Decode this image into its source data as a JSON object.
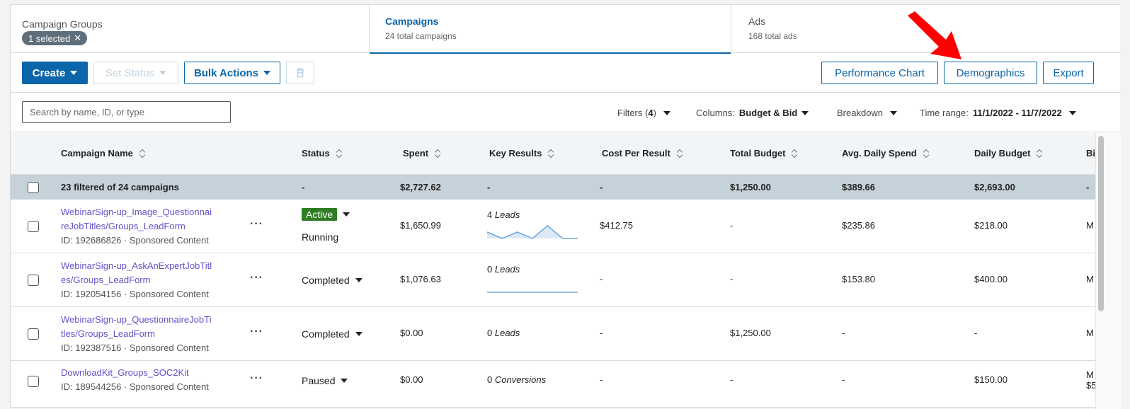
{
  "tabs": {
    "groups": {
      "title": "Campaign Groups",
      "chip": "1 selected"
    },
    "campaigns": {
      "title": "Campaigns",
      "sub": "24 total campaigns"
    },
    "ads": {
      "title": "Ads",
      "sub": "168 total ads"
    }
  },
  "toolbar": {
    "create": "Create",
    "set_status": "Set Status",
    "bulk_actions": "Bulk Actions",
    "performance_chart": "Performance Chart",
    "demographics": "Demographics",
    "export": "Export"
  },
  "filters": {
    "search_placeholder": "Search by name, ID, or type",
    "filters_label": "Filters (",
    "filters_count": "4",
    "filters_close": ")",
    "columns_label": "Columns:",
    "columns_value": "Budget & Bid",
    "breakdown": "Breakdown",
    "time_label": "Time range:",
    "time_value": "11/1/2022 - 11/7/2022"
  },
  "columns": [
    "Campaign Name",
    "Status",
    "Spent",
    "Key Results",
    "Cost Per Result",
    "Total Budget",
    "Avg. Daily Spend",
    "Daily Budget",
    "Bi"
  ],
  "summary": {
    "label": "23 filtered of 24 campaigns",
    "status": "-",
    "spent": "$2,727.62",
    "key_results": "-",
    "cost_per_result": "-",
    "total_budget": "$1,250.00",
    "avg_daily_spend": "$389.66",
    "daily_budget": "$2,693.00",
    "bid": "-"
  },
  "rows": [
    {
      "name_line1": "WebinarSign-up_Image_Questionnai",
      "name_line2": "reJobTitles/Groups_LeadForm",
      "meta": "ID: 192686826 · Sponsored Content",
      "status_badge": "Active",
      "status_sub": "Running",
      "spent": "$1,650.99",
      "kr_count": "4",
      "kr_unit": "Leads",
      "sparkline": [
        1,
        0,
        1,
        0,
        2,
        0,
        0
      ],
      "cost_per_result": "$412.75",
      "total_budget": "-",
      "avg_daily_spend": "$235.86",
      "daily_budget": "$218.00",
      "bid": "M"
    },
    {
      "name_line1": "WebinarSign-up_AskAnExpertJobTitl",
      "name_line2": "es/Groups_LeadForm",
      "meta": "ID: 192054156 · Sponsored Content",
      "status": "Completed",
      "spent": "$1,076.63",
      "kr_count": "0",
      "kr_unit": "Leads",
      "sparkline": [
        0,
        0,
        0,
        0,
        0,
        0,
        0
      ],
      "cost_per_result": "-",
      "total_budget": "-",
      "avg_daily_spend": "$153.80",
      "daily_budget": "$400.00",
      "bid": "M"
    },
    {
      "name_line1": "WebinarSign-up_QuestionnaireJobTi",
      "name_line2": "tles/Groups_LeadForm",
      "meta": "ID: 192387516 · Sponsored Content",
      "status": "Completed",
      "spent": "$0.00",
      "kr_count": "0",
      "kr_unit": "Leads",
      "cost_per_result": "-",
      "total_budget": "$1,250.00",
      "avg_daily_spend": "-",
      "daily_budget": "-",
      "bid": "M"
    },
    {
      "name_line1": "DownloadKit_Groups_SOC2Kit",
      "meta": "ID: 189544256 · Sponsored Content",
      "status": "Paused",
      "spent": "$0.00",
      "kr_count": "0",
      "kr_unit": "Conversions",
      "cost_per_result": "-",
      "total_budget": "-",
      "avg_daily_spend": "-",
      "daily_budget": "$150.00",
      "bid": "M",
      "bid_line2": "$5"
    }
  ],
  "colors": {
    "brand": "#0a66a8",
    "active": "#2e7d23",
    "link": "#6751c9",
    "annotation_arrow": "#ff0000"
  }
}
